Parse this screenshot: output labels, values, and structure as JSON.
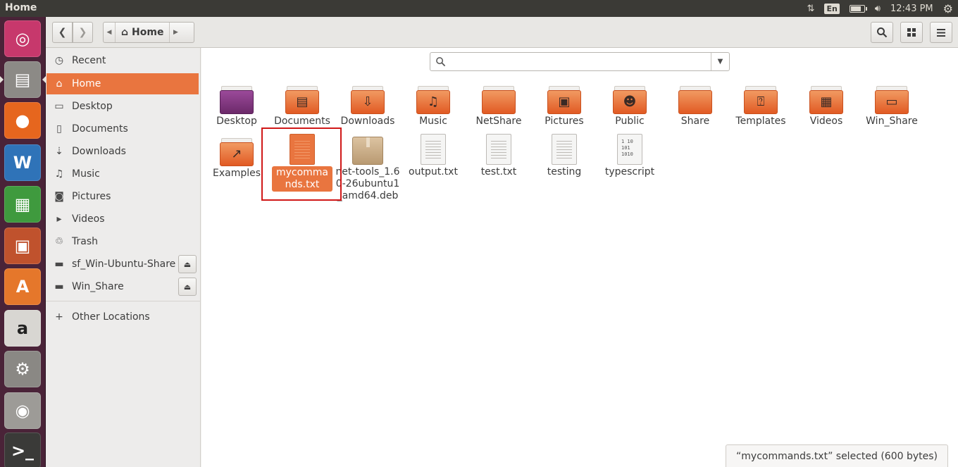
{
  "window": {
    "title": "Home"
  },
  "indicators": {
    "lang": "En",
    "time": "12:43 PM",
    "battery_level": 0.8
  },
  "launcher": {
    "items": [
      {
        "name": "ubuntu-dash-icon",
        "glyph": "◎",
        "color": "#c7386c"
      },
      {
        "name": "files-app-icon",
        "glyph": "▤",
        "color": "#8c8a86"
      },
      {
        "name": "firefox-icon",
        "glyph": "●",
        "color": "#e6661e"
      },
      {
        "name": "libreoffice-writer-icon",
        "glyph": "W",
        "color": "#2f73b8"
      },
      {
        "name": "libreoffice-calc-icon",
        "glyph": "▦",
        "color": "#3f9a3e"
      },
      {
        "name": "libreoffice-impress-icon",
        "glyph": "▣",
        "color": "#c0522d"
      },
      {
        "name": "software-center-icon",
        "glyph": "A",
        "color": "#e5772b"
      },
      {
        "name": "amazon-icon",
        "glyph": "a",
        "color": "#d8d6d2"
      },
      {
        "name": "system-settings-icon",
        "glyph": "⚙",
        "color": "#8a8884"
      },
      {
        "name": "camera-icon",
        "glyph": "◉",
        "color": "#9d9b97"
      },
      {
        "name": "terminal-icon",
        "glyph": ">_",
        "color": "#3a3a38"
      }
    ]
  },
  "header": {
    "path_home": "Home"
  },
  "sidebar": {
    "items": [
      {
        "icon": "◷",
        "icon_name": "recent-icon",
        "label": "Recent"
      },
      {
        "icon": "⌂",
        "icon_name": "home-icon",
        "label": "Home"
      },
      {
        "icon": "▭",
        "icon_name": "desktop-icon",
        "label": "Desktop"
      },
      {
        "icon": "▯",
        "icon_name": "documents-icon",
        "label": "Documents"
      },
      {
        "icon": "⇣",
        "icon_name": "downloads-icon",
        "label": "Downloads"
      },
      {
        "icon": "♫",
        "icon_name": "music-icon",
        "label": "Music"
      },
      {
        "icon": "◙",
        "icon_name": "pictures-icon",
        "label": "Pictures"
      },
      {
        "icon": "▸",
        "icon_name": "videos-icon",
        "label": "Videos"
      },
      {
        "icon": "♲",
        "icon_name": "trash-icon",
        "label": "Trash"
      },
      {
        "icon": "▬",
        "icon_name": "drive-icon",
        "label": "sf_Win-Ubuntu-Share"
      },
      {
        "icon": "▬",
        "icon_name": "drive-icon",
        "label": "Win_Share"
      }
    ],
    "other_icon": "+",
    "other": "Other Locations",
    "eject": "⏏"
  },
  "files": {
    "row1": [
      {
        "label": "Desktop",
        "emb": ""
      },
      {
        "label": "Documents",
        "emb": "▤"
      },
      {
        "label": "Downloads",
        "emb": "⇩"
      },
      {
        "label": "Music",
        "emb": "♫"
      },
      {
        "label": "NetShare",
        "emb": ""
      },
      {
        "label": "Pictures",
        "emb": "▣"
      },
      {
        "label": "Public",
        "emb": "☻"
      },
      {
        "label": "Share",
        "emb": ""
      },
      {
        "label": "Templates",
        "emb": "⍰"
      },
      {
        "label": "Videos",
        "emb": "▦"
      },
      {
        "label": "Win_Share",
        "emb": "▭"
      }
    ],
    "row2": [
      {
        "label": "Examples",
        "kind": "folder",
        "emb": "↗"
      },
      {
        "label": "mycommands.txt",
        "kind": "doc",
        "selected": true
      },
      {
        "label": "net-tools_1.60-26ubuntu1_amd64.deb",
        "kind": "pkg"
      },
      {
        "label": "output.txt",
        "kind": "doc"
      },
      {
        "label": "test.txt",
        "kind": "doc"
      },
      {
        "label": "testing",
        "kind": "doc"
      },
      {
        "label": "typescript",
        "kind": "bin",
        "emb": "1 10 101 1010"
      }
    ]
  },
  "status": {
    "text": "“mycommands.txt” selected  (600 bytes)"
  }
}
